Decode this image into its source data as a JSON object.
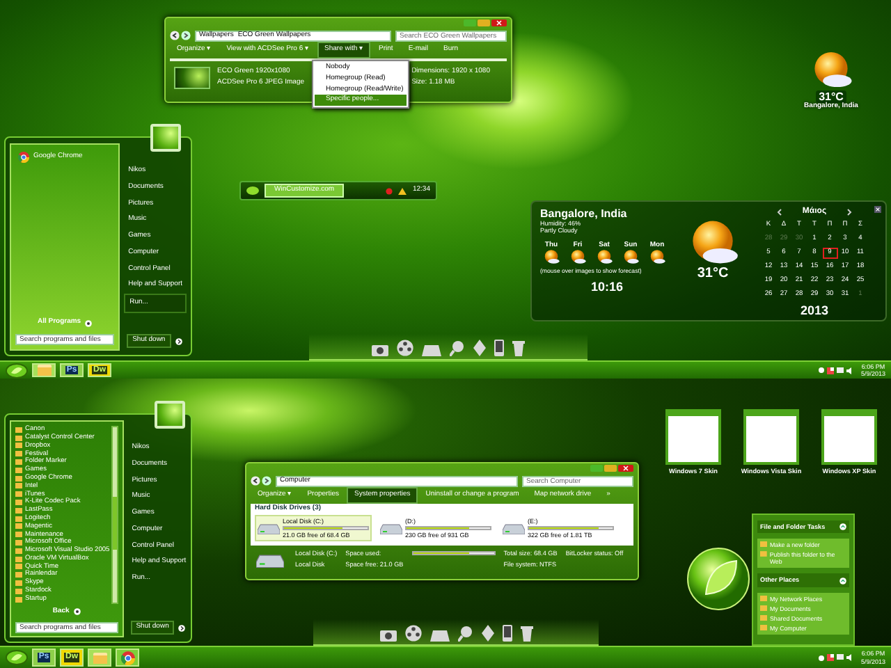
{
  "top_explorer": {
    "path": [
      "Wallpapers",
      "ECO Green Wallpapers"
    ],
    "search": {
      "placeholder": "Search ECO Green Wallpapers"
    },
    "toolbar": [
      {
        "label": "Organize ▾",
        "selected": false
      },
      {
        "label": "View with ACDSee Pro 6 ▾",
        "selected": false
      },
      {
        "label": "Share with ▾",
        "selected": true
      },
      {
        "label": "Print",
        "selected": false
      },
      {
        "label": "E-mail",
        "selected": false
      },
      {
        "label": "Burn",
        "selected": false
      }
    ],
    "share_menu": [
      {
        "label": "Nobody",
        "selected": false
      },
      {
        "label": "Homegroup (Read)",
        "selected": false
      },
      {
        "label": "Homegroup (Read/Write)",
        "selected": false
      },
      {
        "label": "Specific people...",
        "selected": true
      }
    ],
    "details": {
      "name": "ECO Green 1920x1080",
      "type": "ACDSee Pro 6 JPEG Image",
      "dimensions": "Dimensions: 1920 x 1080",
      "size": "Size: 1.18 MB"
    }
  },
  "clock_gadget": {
    "temperature": "31°C",
    "city": "Bangalore, India"
  },
  "bar_gadget": {
    "site": "WinCustomize.com",
    "time": "12:34"
  },
  "start_menu_top": {
    "pinned": [
      {
        "label": "Google Chrome"
      }
    ],
    "all_programs": "All Programs",
    "search": {
      "placeholder": "Search programs and files"
    },
    "places": [
      {
        "label": "Nikos",
        "selected": false
      },
      {
        "label": "Documents",
        "selected": false
      },
      {
        "label": "Pictures",
        "selected": false
      },
      {
        "label": "Music",
        "selected": false
      },
      {
        "label": "Games",
        "selected": false
      },
      {
        "label": "Computer",
        "selected": false
      },
      {
        "label": "Control Panel",
        "selected": false
      },
      {
        "label": "Help and Support",
        "selected": false
      },
      {
        "label": "Run...",
        "selected": true
      }
    ],
    "shutdown": "Shut down"
  },
  "weather": {
    "city": "Bangalore, India",
    "humidity": "Humidity: 46%",
    "condition": "Partly Cloudy",
    "days": [
      "Thu",
      "Fri",
      "Sat",
      "Sun",
      "Mon"
    ],
    "hint": "(mouse over images to show forecast)",
    "time": "10:16",
    "temperature": "31°C"
  },
  "calendar": {
    "month": "Μάιος",
    "weekdays": [
      "Κ",
      "Δ",
      "Τ",
      "Τ",
      "Π",
      "Π",
      "Σ"
    ],
    "year": "2013",
    "weeks": [
      [
        {
          "label": "28",
          "muted": true,
          "selected": false
        },
        {
          "label": "29",
          "muted": true,
          "selected": false
        },
        {
          "label": "30",
          "muted": true,
          "selected": false
        },
        {
          "label": "1",
          "muted": false,
          "selected": false
        },
        {
          "label": "2",
          "muted": false,
          "selected": false
        },
        {
          "label": "3",
          "muted": false,
          "selected": false
        },
        {
          "label": "4",
          "muted": false,
          "selected": false
        }
      ],
      [
        {
          "label": "5",
          "muted": false,
          "selected": false
        },
        {
          "label": "6",
          "muted": false,
          "selected": false
        },
        {
          "label": "7",
          "muted": false,
          "selected": false
        },
        {
          "label": "8",
          "muted": false,
          "selected": false
        },
        {
          "label": "9",
          "muted": false,
          "selected": true
        },
        {
          "label": "10",
          "muted": false,
          "selected": false
        },
        {
          "label": "11",
          "muted": false,
          "selected": false
        }
      ],
      [
        {
          "label": "12",
          "muted": false,
          "selected": false
        },
        {
          "label": "13",
          "muted": false,
          "selected": false
        },
        {
          "label": "14",
          "muted": false,
          "selected": false
        },
        {
          "label": "15",
          "muted": false,
          "selected": false
        },
        {
          "label": "16",
          "muted": false,
          "selected": false
        },
        {
          "label": "17",
          "muted": false,
          "selected": false
        },
        {
          "label": "18",
          "muted": false,
          "selected": false
        }
      ],
      [
        {
          "label": "19",
          "muted": false,
          "selected": false
        },
        {
          "label": "20",
          "muted": false,
          "selected": false
        },
        {
          "label": "21",
          "muted": false,
          "selected": false
        },
        {
          "label": "22",
          "muted": false,
          "selected": false
        },
        {
          "label": "23",
          "muted": false,
          "selected": false
        },
        {
          "label": "24",
          "muted": false,
          "selected": false
        },
        {
          "label": "25",
          "muted": false,
          "selected": false
        }
      ],
      [
        {
          "label": "26",
          "muted": false,
          "selected": false
        },
        {
          "label": "27",
          "muted": false,
          "selected": false
        },
        {
          "label": "28",
          "muted": false,
          "selected": false
        },
        {
          "label": "29",
          "muted": false,
          "selected": false
        },
        {
          "label": "30",
          "muted": false,
          "selected": false
        },
        {
          "label": "31",
          "muted": false,
          "selected": false
        },
        {
          "label": "1",
          "muted": true,
          "selected": false
        }
      ]
    ]
  },
  "taskbar_top": {
    "apps": [
      {
        "kind": "folder"
      },
      {
        "kind": "photoshop",
        "label": "Ps"
      },
      {
        "kind": "dreamweaver",
        "label": "Dw"
      }
    ],
    "time": "6:06 PM",
    "date": "5/9/2013"
  },
  "start_menu_bottom": {
    "programs": [
      "Canon",
      "Catalyst Control Center",
      "Dropbox",
      "Festival",
      "Folder Marker",
      "Games",
      "Google Chrome",
      "Intel",
      "iTunes",
      "K-Lite Codec Pack",
      "LastPass",
      "Logitech",
      "Magentic",
      "Maintenance",
      "Microsoft Office",
      "Microsoft Visual Studio 2005",
      "Oracle VM VirtualBox",
      "Quick Time",
      "Rainlendar",
      "Skype",
      "Stardock",
      "Startup"
    ],
    "back": "Back",
    "search": {
      "placeholder": "Search programs and files"
    },
    "places": [
      {
        "label": "Nikos",
        "selected": false
      },
      {
        "label": "Documents",
        "selected": false
      },
      {
        "label": "Pictures",
        "selected": false
      },
      {
        "label": "Music",
        "selected": false
      },
      {
        "label": "Games",
        "selected": false
      },
      {
        "label": "Computer",
        "selected": false
      },
      {
        "label": "Control Panel",
        "selected": false
      },
      {
        "label": "Help and Support",
        "selected": false
      },
      {
        "label": "Run...",
        "selected": false
      }
    ],
    "shutdown": "Shut down"
  },
  "bottom_explorer": {
    "path": [
      "Computer"
    ],
    "search": {
      "placeholder": "Search Computer"
    },
    "toolbar": [
      {
        "label": "Organize ▾",
        "selected": false
      },
      {
        "label": "Properties",
        "selected": false
      },
      {
        "label": "System properties",
        "selected": true
      },
      {
        "label": "Uninstall or change a program",
        "selected": false
      },
      {
        "label": "Map network drive",
        "selected": false
      },
      {
        "label": "»",
        "selected": false
      }
    ],
    "group": "Hard Disk Drives (3)",
    "drives": [
      {
        "name": "Local Disk (C:)",
        "free": "21.0 GB free of 68.4 GB",
        "level": 0.7,
        "selected": true
      },
      {
        "name": "(D:)",
        "free": "230 GB free of 931 GB",
        "level": 0.75,
        "selected": false
      },
      {
        "name": "(E:)",
        "free": "322 GB free of 1.81 TB",
        "level": 0.83,
        "selected": false
      }
    ],
    "details": {
      "name": "Local Disk (C:)",
      "used_label": "Space used:",
      "level": 0.7,
      "total": "Total size: 68.4 GB",
      "bitlocker": "BitLocker status: Off",
      "type": "Local Disk",
      "free": "Space free: 21.0 GB",
      "filesystem": "File system: NTFS"
    }
  },
  "skins": [
    "Windows 7 Skin",
    "Windows Vista Skin",
    "Windows XP Skin"
  ],
  "task_pane": [
    {
      "title": "File and Folder Tasks",
      "links": [
        "Make a new folder",
        "Publish this folder to the Web"
      ]
    },
    {
      "title": "Other Places",
      "links": [
        "My Network Places",
        "My Documents",
        "Shared Documents",
        "My Computer"
      ]
    }
  ],
  "taskbar_bottom": {
    "apps": [
      {
        "kind": "photoshop",
        "label": "Ps"
      },
      {
        "kind": "dreamweaver",
        "label": "Dw"
      },
      {
        "kind": "folder"
      },
      {
        "kind": "chrome"
      }
    ],
    "time": "6:06 PM",
    "date": "5/9/2013"
  }
}
